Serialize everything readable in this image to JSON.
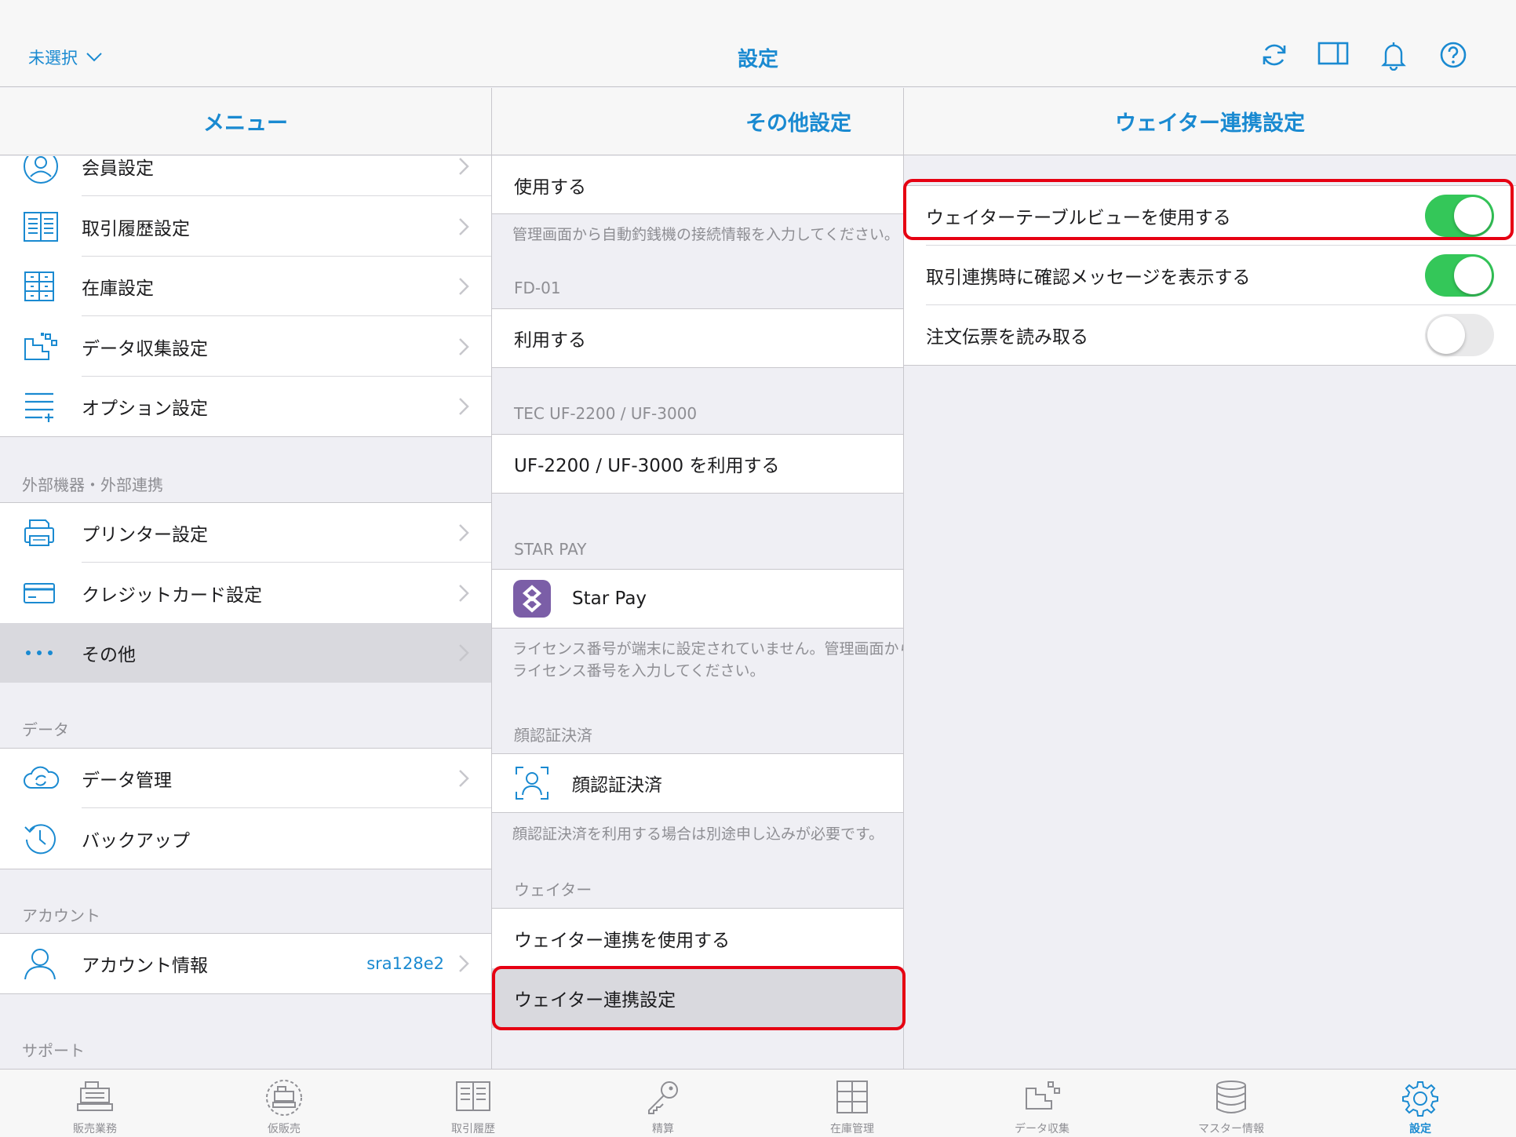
{
  "topbar": {
    "store_select": "未選択",
    "title": "設定",
    "icons": [
      "refresh-icon",
      "split-view-icon",
      "bell-icon",
      "help-icon"
    ]
  },
  "menu": {
    "header": "メニュー",
    "items_top": [
      {
        "label": "会員設定",
        "icon": "member-icon"
      },
      {
        "label": "取引履歴設定",
        "icon": "history-icon"
      },
      {
        "label": "在庫設定",
        "icon": "stock-icon"
      },
      {
        "label": "データ収集設定",
        "icon": "data-collection-icon"
      },
      {
        "label": "オプション設定",
        "icon": "option-icon"
      }
    ],
    "section_external": "外部機器・外部連携",
    "items_external": [
      {
        "label": "プリンター設定",
        "icon": "printer-icon"
      },
      {
        "label": "クレジットカード設定",
        "icon": "credit-card-icon"
      },
      {
        "label": "その他",
        "icon": "more-icon",
        "selected": true
      }
    ],
    "section_data": "データ",
    "items_data": [
      {
        "label": "データ管理",
        "icon": "cloud-icon"
      },
      {
        "label": "バックアップ",
        "icon": "backup-icon"
      }
    ],
    "section_account": "アカウント",
    "account": {
      "label": "アカウント情報",
      "value": "sra128e2",
      "icon": "user-icon"
    },
    "section_support": "サポート"
  },
  "other": {
    "header": "その他設定",
    "row_use": "使用する",
    "note_auto_changer": "管理画面から自動釣銭機の接続情報を入力してください。",
    "section_fd01": "FD-01",
    "row_fd01": "利用する",
    "section_tec": "TEC UF-2200 / UF-3000",
    "row_tec": "UF-2200 / UF-3000 を利用する",
    "section_starpay": "STAR PAY",
    "row_starpay": "Star Pay",
    "note_starpay_1": "ライセンス番号が端末に設定されていません。管理画面から",
    "note_starpay_2": "ライセンス番号を入力してください。",
    "section_face": "顔認証決済",
    "row_face": "顔認証決済",
    "note_face": "顔認証決済を利用する場合は別途申し込みが必要です。",
    "section_waiter": "ウェイター",
    "row_waiter_use": "ウェイター連携を使用する",
    "row_waiter_settings": "ウェイター連携設定"
  },
  "waiter": {
    "header": "ウェイター連携設定",
    "rows": [
      {
        "label": "ウェイターテーブルビューを使用する",
        "on": true
      },
      {
        "label": "取引連携時に確認メッセージを表示する",
        "on": true
      },
      {
        "label": "注文伝票を読み取る",
        "on": false
      }
    ]
  },
  "tabbar": [
    {
      "label": "販売業務",
      "icon": "register-icon"
    },
    {
      "label": "仮販売",
      "icon": "temp-sale-icon"
    },
    {
      "label": "取引履歴",
      "icon": "transaction-history-icon"
    },
    {
      "label": "精算",
      "icon": "key-icon"
    },
    {
      "label": "在庫管理",
      "icon": "inventory-icon"
    },
    {
      "label": "データ収集",
      "icon": "data-collect-icon"
    },
    {
      "label": "マスター情報",
      "icon": "database-icon"
    },
    {
      "label": "設定",
      "icon": "settings-gear-icon",
      "active": true
    }
  ],
  "colors": {
    "accent": "#1a8ad1",
    "toggle_on": "#34c759",
    "highlight": "#e60012"
  }
}
